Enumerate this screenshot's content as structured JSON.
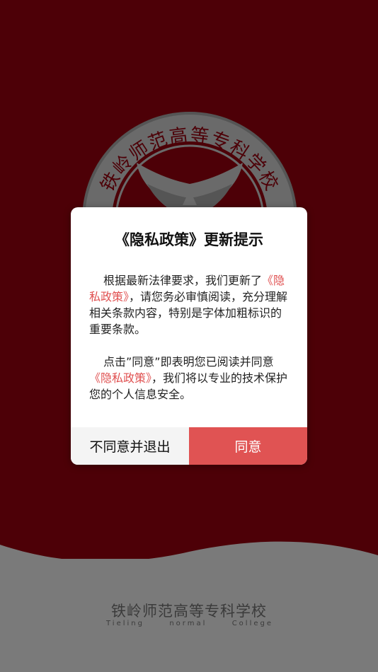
{
  "colors": {
    "background_dark": "#4d0007",
    "footer_gray": "#7a7a7a",
    "accent": "#e05353",
    "link": "#e05050"
  },
  "splash": {
    "seal_text": "铁岭师范高等专科学校",
    "school_name": "铁岭师范高等专科学校",
    "school_name_en": [
      "Tieling",
      "normal",
      "College"
    ]
  },
  "dialog": {
    "title": "《隐私政策》更新提示",
    "paragraph1": {
      "text_a": "根据最新法律要求，我们更新了",
      "link": "《隐私政策》",
      "text_b": "，请您务必审慎阅读，充分理解相关条款内容，特别是字体加粗标识的重要条款。"
    },
    "paragraph2": {
      "text_a": "点击”同意”即表明您已阅读并同意",
      "link": "《隐私政策》",
      "text_b": "，我们将以专业的技术保护您的个人信息安全。"
    },
    "decline_label": "不同意并退出",
    "agree_label": "同意"
  }
}
